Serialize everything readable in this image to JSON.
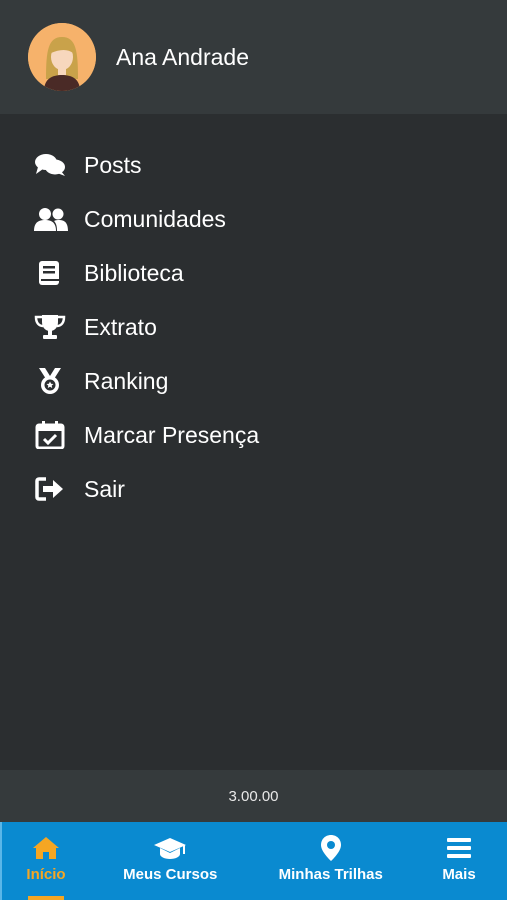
{
  "profile": {
    "name": "Ana Andrade",
    "avatar_icon": "female-avatar-icon"
  },
  "menu": {
    "items": [
      {
        "label": "Posts",
        "icon": "comments-icon"
      },
      {
        "label": "Comunidades",
        "icon": "users-icon"
      },
      {
        "label": "Biblioteca",
        "icon": "book-icon"
      },
      {
        "label": "Extrato",
        "icon": "trophy-icon"
      },
      {
        "label": "Ranking",
        "icon": "medal-icon"
      },
      {
        "label": "Marcar Presença",
        "icon": "calendar-check-icon"
      },
      {
        "label": "Sair",
        "icon": "sign-out-icon"
      }
    ]
  },
  "footer": {
    "version": "3.00.00"
  },
  "bottom_nav": {
    "items": [
      {
        "label": "Início",
        "icon": "home-icon",
        "active": true
      },
      {
        "label": "Meus Cursos",
        "icon": "graduation-cap-icon",
        "active": false
      },
      {
        "label": "Minhas Trilhas",
        "icon": "map-marker-icon",
        "active": false
      },
      {
        "label": "Mais",
        "icon": "hamburger-menu-icon",
        "active": false
      }
    ]
  },
  "colors": {
    "background": "#2b2e30",
    "header": "#353a3c",
    "nav_bar": "#0a8ad0",
    "active_accent": "#f5a623",
    "text": "#ffffff"
  }
}
